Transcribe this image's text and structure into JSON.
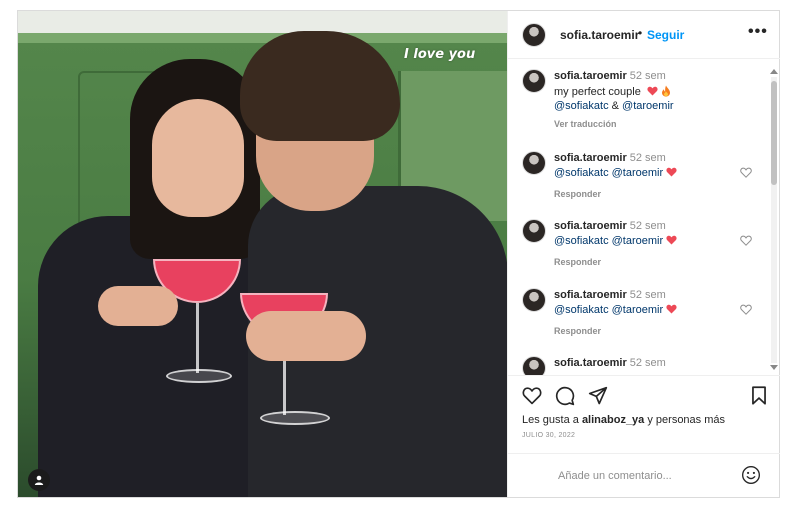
{
  "post": {
    "image": {
      "overlay_text": "I love you"
    },
    "header": {
      "username": "sofia.taroemir",
      "separator": "•",
      "follow_label": "Seguir",
      "more_label": "•••"
    },
    "caption": {
      "username": "sofia.taroemir",
      "time": "52 sem",
      "text": "my perfect couple",
      "emojis": [
        "heart-icon",
        "fire-icon"
      ],
      "mention1": "@sofiakatc",
      "connector": "&",
      "mention2": "@taroemir",
      "translate_label": "Ver traducción"
    },
    "comments": [
      {
        "username": "sofia.taroemir",
        "time": "52 sem",
        "mention1": "@sofiakatc",
        "mention2": "@taroemir",
        "reply_label": "Responder"
      },
      {
        "username": "sofia.taroemir",
        "time": "52 sem",
        "mention1": "@sofiakatc",
        "mention2": "@taroemir",
        "reply_label": "Responder"
      },
      {
        "username": "sofia.taroemir",
        "time": "52 sem",
        "mention1": "@sofiakatc",
        "mention2": "@taroemir",
        "reply_label": "Responder"
      },
      {
        "username": "sofia.taroemir",
        "time": "52 sem"
      }
    ],
    "likes": {
      "prefix": "Les gusta a",
      "user": "alinaboz_ya",
      "suffix": "y personas más"
    },
    "date": "JULIO 30, 2022",
    "add_comment": {
      "placeholder": "Añade un comentario..."
    },
    "icons": [
      "heart-icon",
      "comment-icon",
      "share-icon",
      "bookmark-icon",
      "emoji-icon",
      "user-tag-icon"
    ],
    "colors": {
      "accent": "#0095f6",
      "heart": "#ed4956",
      "mention": "#00376b",
      "muted": "#8e8e8e"
    }
  }
}
